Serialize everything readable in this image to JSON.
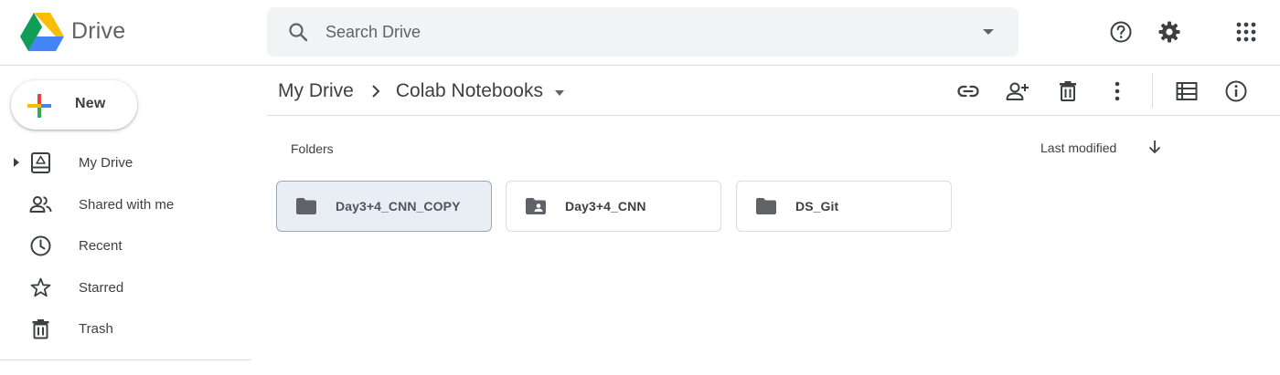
{
  "app": {
    "name": "Drive"
  },
  "search": {
    "placeholder": "Search Drive"
  },
  "header_icons": [
    "help-icon",
    "settings-icon",
    "apps-grid-icon"
  ],
  "new_button": {
    "label": "New"
  },
  "sidebar": {
    "items": [
      {
        "label": "My Drive",
        "icon": "my-drive-icon",
        "expandable": true
      },
      {
        "label": "Shared with me",
        "icon": "shared-people-icon",
        "expandable": false
      },
      {
        "label": "Recent",
        "icon": "clock-icon",
        "expandable": false
      },
      {
        "label": "Starred",
        "icon": "star-icon",
        "expandable": false
      },
      {
        "label": "Trash",
        "icon": "trash-icon",
        "expandable": false
      }
    ]
  },
  "breadcrumb": {
    "root": "My Drive",
    "current": "Colab Notebooks"
  },
  "toolbar_icons": [
    "link-icon",
    "add-person-icon",
    "trash-icon",
    "more-vert-icon",
    "list-view-icon",
    "info-icon"
  ],
  "content": {
    "section_title": "Folders",
    "sort": {
      "label": "Last modified",
      "direction": "descending"
    },
    "folders": [
      {
        "name": "Day3+4_CNN_COPY",
        "type": "folder",
        "selected": true
      },
      {
        "name": "Day3+4_CNN",
        "type": "shared-folder",
        "selected": false
      },
      {
        "name": "DS_Git",
        "type": "folder",
        "selected": false
      }
    ]
  },
  "colors": {
    "text": "#3c4043",
    "icon": "#5f6368",
    "search_bg": "#f1f3f4",
    "divider": "#dadce0",
    "selected_bg": "#e8eef4",
    "logo_yellow": "#fbbc04",
    "logo_blue": "#4285f4",
    "logo_green": "#0f9d58"
  }
}
